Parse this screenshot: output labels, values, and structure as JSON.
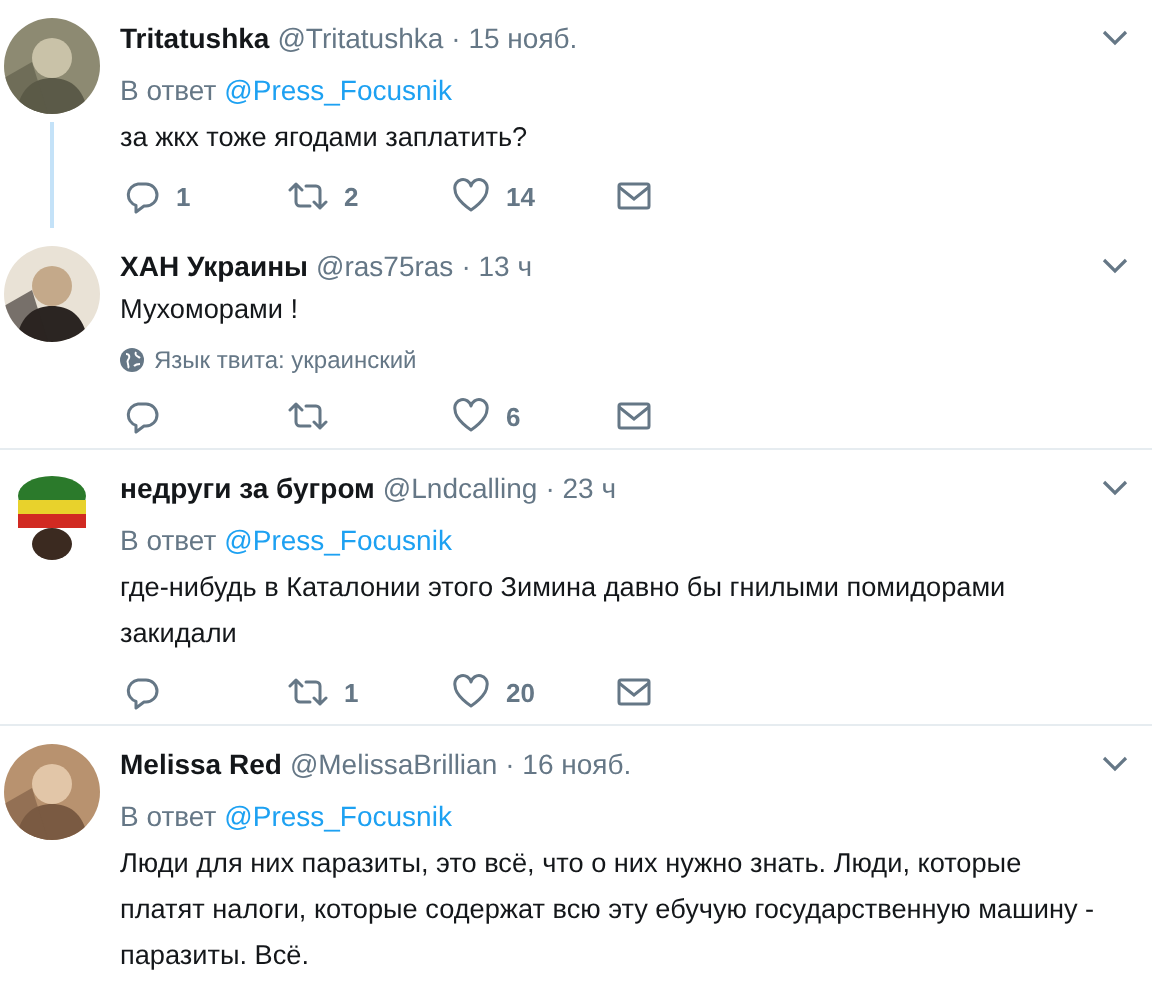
{
  "tweets": [
    {
      "name": "Tritatushka",
      "handle": "@Tritatushka",
      "date": "· 15 нояб.",
      "reply_to": {
        "prefix": "В ответ",
        "handle": "@Press_Focusnik"
      },
      "text": "за жкх тоже ягодами заплатить?",
      "thread_continues": true,
      "actions": [
        {
          "kind": "reply",
          "count": "1"
        },
        {
          "kind": "retweet",
          "count": "2"
        },
        {
          "kind": "like",
          "count": "14"
        },
        {
          "kind": "message"
        }
      ]
    },
    {
      "name": "ХАН Украины",
      "handle": "@ras75ras",
      "date": "· 13 ч",
      "text": "Мухоморами !",
      "language_note": "Язык твита: украинский",
      "thread_continues": false,
      "actions": [
        {
          "kind": "reply"
        },
        {
          "kind": "retweet"
        },
        {
          "kind": "like",
          "count": "6"
        },
        {
          "kind": "message"
        }
      ]
    },
    {
      "name": "недруги за бугром",
      "handle": "@Lndcalling",
      "date": "· 23 ч",
      "reply_to": {
        "prefix": "В ответ",
        "handle": "@Press_Focusnik"
      },
      "text": "где-нибудь в Каталонии этого Зимина давно бы гнилыми помидорами закидали",
      "thread_continues": false,
      "actions": [
        {
          "kind": "reply"
        },
        {
          "kind": "retweet",
          "count": "1"
        },
        {
          "kind": "like",
          "count": "20"
        },
        {
          "kind": "message"
        }
      ]
    },
    {
      "name": "Melissa Red",
      "handle": "@MelissaBrillian",
      "date": "· 16 нояб.",
      "reply_to": {
        "prefix": "В ответ",
        "handle": "@Press_Focusnik"
      },
      "text": "Люди для них паразиты, это всё, что о них нужно знать. Люди, которые платят налоги, которые содержат всю эту ебучую государственную машину - паразиты. Всё.",
      "thread_continues": false
    }
  ]
}
